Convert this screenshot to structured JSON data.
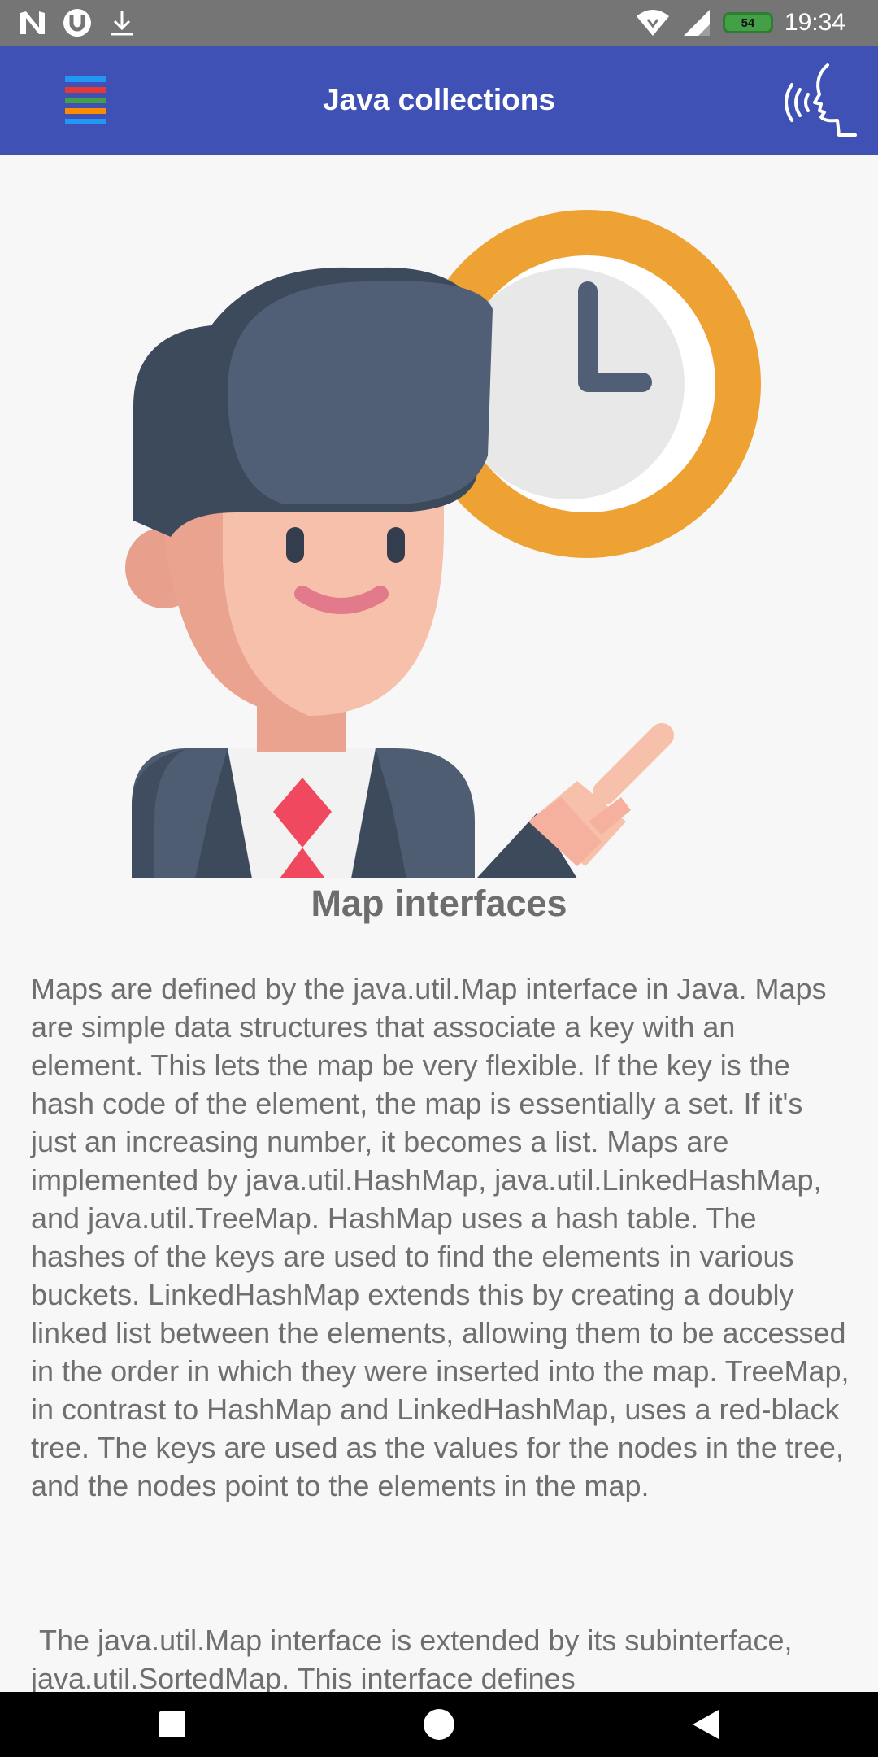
{
  "status_bar": {
    "time": "19:34",
    "battery_level": "54",
    "icons": [
      "notification-n-icon",
      "torrent-icon",
      "download-icon",
      "wifi-icon",
      "signal-icon",
      "battery-icon"
    ]
  },
  "app_bar": {
    "title": "Java collections",
    "menu_icon": "hamburger-menu-icon",
    "menu_colors": [
      "#2196f3",
      "#e53935",
      "#43a047",
      "#fb8c00",
      "#2196f3"
    ],
    "voice_icon": "speaking-head-icon"
  },
  "illustration": {
    "icon": "businessman-clock-illustration"
  },
  "article": {
    "title": "Map interfaces",
    "paragraph1": "Maps are defined by the java.util.Map interface in Java. Maps are simple data structures that associate a key with an element. This lets the map be very flexible. If the key is the hash code of the element, the map is essentially a set. If it's just an increasing number, it becomes a list. Maps are implemented by java.util.HashMap, java.util.LinkedHashMap, and java.util.TreeMap. HashMap uses a hash table. The hashes of the keys are used to find the elements in various buckets. LinkedHashMap extends this by creating a doubly linked list between the elements, allowing them to be accessed in the order in which they were inserted into the map. TreeMap, in contrast to HashMap and LinkedHashMap, uses a red-black tree. The keys are used as the values for the nodes in the tree, and the nodes point to the elements in the map.",
    "paragraph2": " The java.util.Map interface is extended by its subinterface, java.util.SortedMap. This interface defines"
  },
  "nav_bar": {
    "buttons": [
      "recents-square-icon",
      "home-circle-icon",
      "back-triangle-icon"
    ]
  },
  "colors": {
    "app_bar": "#3f51b5",
    "status_bar": "#757575",
    "text": "#6f6f6f"
  }
}
